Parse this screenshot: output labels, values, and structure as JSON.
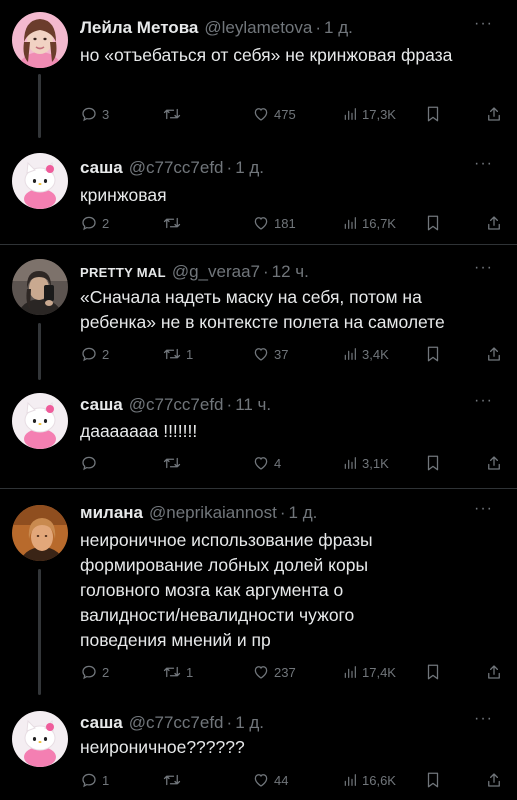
{
  "tweets": [
    {
      "name": "Лейла Метова",
      "handle": "@leylametova",
      "time": "1 д.",
      "more": "···",
      "text": "но «отъебаться от себя» не кринжовая фраза",
      "replies": "3",
      "retweets": "",
      "likes": "475",
      "views": "17,3K",
      "avatar": "pink-portrait"
    },
    {
      "name": "саша",
      "handle": "@c77cc7efd",
      "time": "1 д.",
      "more": "···",
      "text": "кринжовая",
      "replies": "2",
      "retweets": "",
      "likes": "181",
      "views": "16,7K",
      "avatar": "hello-kitty-plush"
    },
    {
      "name": "PRETTY MAL",
      "handle": "@g_veraa7",
      "time": "12 ч.",
      "more": "···",
      "text": "«Сначала надеть маску на себя, потом на ребенка» не в контексте полета на самолете",
      "replies": "2",
      "retweets": "1",
      "likes": "37",
      "views": "3,4K",
      "avatar": "mirror-selfie"
    },
    {
      "name": "саша",
      "handle": "@c77cc7efd",
      "time": "11 ч.",
      "more": "···",
      "text": "даааааaa !!!!!!!",
      "replies": "",
      "retweets": "",
      "likes": "4",
      "views": "3,1K",
      "avatar": "hello-kitty-plush"
    },
    {
      "name": "милана",
      "handle": "@neprikaiannost",
      "time": "1 д.",
      "more": "···",
      "text": "неироничное использование фразы формирование лобных долей коры головного мозга как аргумента о валидности/невалидности чужого поведения мнений и пр",
      "replies": "2",
      "retweets": "1",
      "likes": "237",
      "views": "17,4K",
      "avatar": "orange-portrait"
    },
    {
      "name": "саша",
      "handle": "@c77cc7efd",
      "time": "1 д.",
      "more": "···",
      "text": "неироничное??????",
      "replies": "1",
      "retweets": "",
      "likes": "44",
      "views": "16,6K",
      "avatar": "hello-kitty-plush"
    }
  ],
  "colors": {
    "background": "#000000",
    "text": "#e7e9ea",
    "muted": "#71767b",
    "divider": "#2f3336"
  }
}
